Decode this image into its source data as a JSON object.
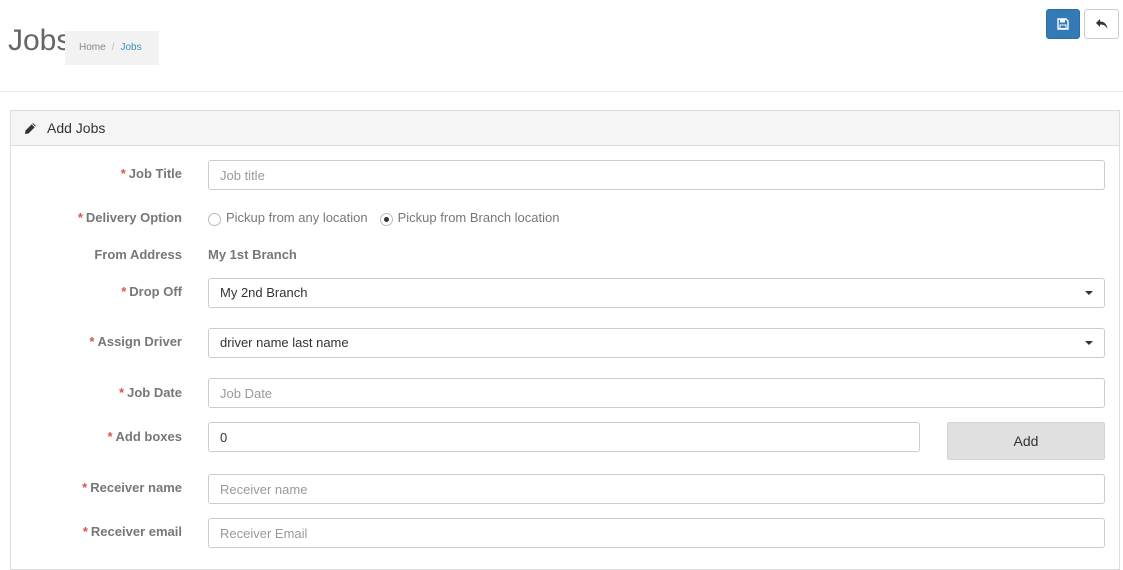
{
  "header": {
    "title": "Jobs",
    "breadcrumb": [
      {
        "label": "Home"
      },
      {
        "label": "Jobs"
      }
    ],
    "save_icon": "floppy-disk-icon",
    "back_icon": "reply-arrow-icon"
  },
  "panel": {
    "title": "Add Jobs",
    "icon": "pencil-icon"
  },
  "form": {
    "job_title": {
      "label": "Job Title",
      "required": "*",
      "placeholder": "Job title",
      "value": ""
    },
    "delivery_option": {
      "label": "Delivery Option",
      "required": "*",
      "options": [
        {
          "label": "Pickup from any location",
          "checked": false
        },
        {
          "label": "Pickup from Branch location",
          "checked": true
        }
      ]
    },
    "from_address": {
      "label": "From Address",
      "value": "My 1st Branch"
    },
    "drop_off": {
      "label": "Drop Off",
      "required": "*",
      "value": "My 2nd Branch"
    },
    "assign_driver": {
      "label": "Assign Driver",
      "required": "*",
      "value": "driver name last name"
    },
    "job_date": {
      "label": "Job Date",
      "required": "*",
      "placeholder": "Job Date",
      "value": ""
    },
    "add_boxes": {
      "label": "Add boxes",
      "required": "*",
      "value": "0",
      "button": "Add"
    },
    "receiver_name": {
      "label": "Receiver name",
      "required": "*",
      "placeholder": "Receiver name",
      "value": ""
    },
    "receiver_email": {
      "label": "Receiver email",
      "required": "*",
      "placeholder": "Receiver Email",
      "value": ""
    }
  },
  "colors": {
    "primary": "#337ab7",
    "required": "#d9534f",
    "link": "#3c8dbc"
  }
}
